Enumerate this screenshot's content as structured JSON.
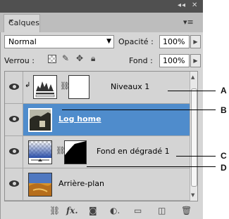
{
  "panel": {
    "tab_label": "Calques",
    "tab_close": "×",
    "window_controls": "◂◂ | ✕",
    "menu_icon": "menu-icon"
  },
  "blend": {
    "mode": "Normal",
    "opacity_label": "Opacité :",
    "opacity_value": "100%"
  },
  "lock": {
    "label": "Verrou :",
    "fill_label": "Fond :",
    "fill_value": "100%"
  },
  "layers": [
    {
      "name": "Niveaux 1",
      "type": "adjustment",
      "visible": true,
      "selected": false
    },
    {
      "name": "Log home",
      "type": "image",
      "visible": true,
      "selected": true
    },
    {
      "name": "Fond en dégradé 1",
      "type": "gradient-fill",
      "visible": true,
      "selected": false
    },
    {
      "name": "Arrière-plan",
      "type": "image",
      "visible": true,
      "selected": false
    }
  ],
  "callouts": [
    "A",
    "B",
    "C",
    "D"
  ],
  "colors": {
    "selection": "#4f8ccc",
    "panel_bg": "#d6d6d6",
    "titlebar": "#505050"
  }
}
